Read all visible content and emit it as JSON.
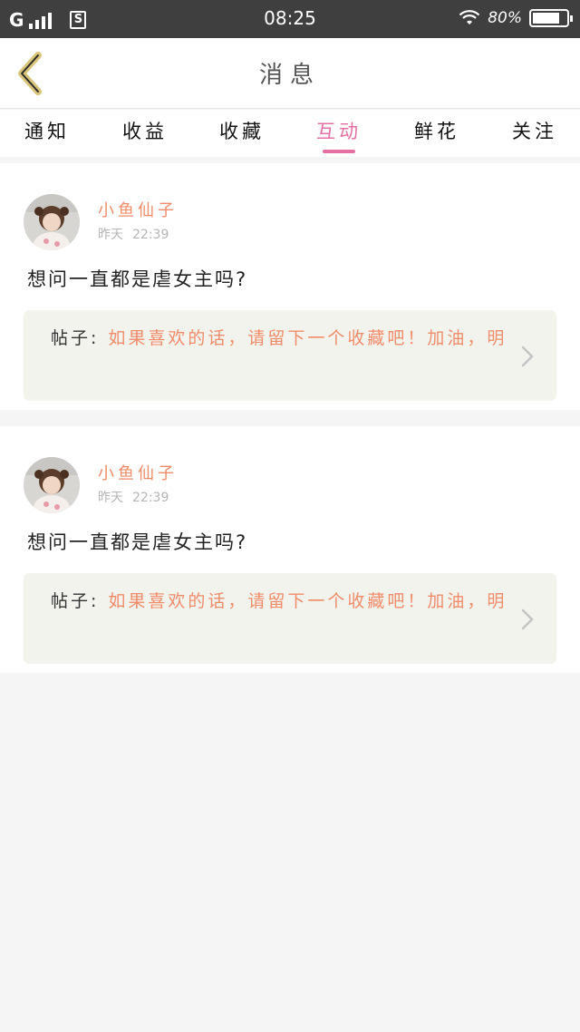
{
  "status_bar": {
    "network": "G",
    "sim_icon": "S",
    "time": "08:25",
    "battery_percent": "80%",
    "battery_level": 0.8
  },
  "nav": {
    "title": "消息"
  },
  "tabs": [
    {
      "label": "通知",
      "active": false
    },
    {
      "label": "收益",
      "active": false
    },
    {
      "label": "收藏",
      "active": false
    },
    {
      "label": "互动",
      "active": true
    },
    {
      "label": "鲜花",
      "active": false
    },
    {
      "label": "关注",
      "active": false
    }
  ],
  "colors": {
    "accent": "#e56fa3",
    "username": "#f08c6a",
    "post_bg": "#f3f3ee"
  },
  "messages": [
    {
      "username": "小鱼仙子",
      "date": "昨天",
      "time": "22:39",
      "comment": "想问一直都是虐女主吗?",
      "post_label": "帖子:",
      "post_text": "如果喜欢的话，请留下一个收藏吧！加油，明"
    },
    {
      "username": "小鱼仙子",
      "date": "昨天",
      "time": "22:39",
      "comment": "想问一直都是虐女主吗?",
      "post_label": "帖子:",
      "post_text": "如果喜欢的话，请留下一个收藏吧！加油，明"
    }
  ]
}
